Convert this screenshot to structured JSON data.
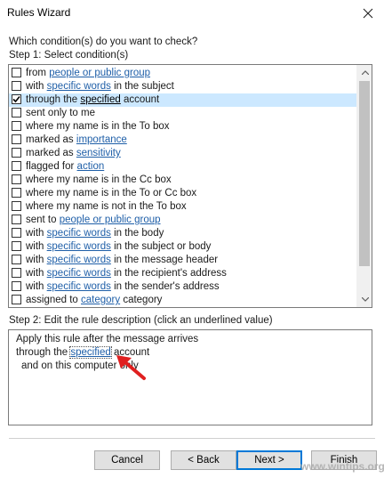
{
  "window": {
    "title": "Rules Wizard",
    "close_icon": "close-icon"
  },
  "prompt": "Which condition(s) do you want to check?",
  "step1_label": "Step 1: Select condition(s)",
  "conditions": [
    {
      "checked": false,
      "selected": false,
      "pre": "from ",
      "link": "people or public group",
      "post": ""
    },
    {
      "checked": false,
      "selected": false,
      "pre": "with ",
      "link": "specific words",
      "post": " in the subject"
    },
    {
      "checked": true,
      "selected": true,
      "pre": "through the ",
      "link": "specified",
      "post": " account"
    },
    {
      "checked": false,
      "selected": false,
      "pre": "sent only to me",
      "link": "",
      "post": ""
    },
    {
      "checked": false,
      "selected": false,
      "pre": "where my name is in the To box",
      "link": "",
      "post": ""
    },
    {
      "checked": false,
      "selected": false,
      "pre": "marked as ",
      "link": "importance",
      "post": ""
    },
    {
      "checked": false,
      "selected": false,
      "pre": "marked as ",
      "link": "sensitivity",
      "post": ""
    },
    {
      "checked": false,
      "selected": false,
      "pre": "flagged for ",
      "link": "action",
      "post": ""
    },
    {
      "checked": false,
      "selected": false,
      "pre": "where my name is in the Cc box",
      "link": "",
      "post": ""
    },
    {
      "checked": false,
      "selected": false,
      "pre": "where my name is in the To or Cc box",
      "link": "",
      "post": ""
    },
    {
      "checked": false,
      "selected": false,
      "pre": "where my name is not in the To box",
      "link": "",
      "post": ""
    },
    {
      "checked": false,
      "selected": false,
      "pre": "sent to ",
      "link": "people or public group",
      "post": ""
    },
    {
      "checked": false,
      "selected": false,
      "pre": "with ",
      "link": "specific words",
      "post": " in the body"
    },
    {
      "checked": false,
      "selected": false,
      "pre": "with ",
      "link": "specific words",
      "post": " in the subject or body"
    },
    {
      "checked": false,
      "selected": false,
      "pre": "with ",
      "link": "specific words",
      "post": " in the message header"
    },
    {
      "checked": false,
      "selected": false,
      "pre": "with ",
      "link": "specific words",
      "post": " in the recipient's address"
    },
    {
      "checked": false,
      "selected": false,
      "pre": "with ",
      "link": "specific words",
      "post": " in the sender's address"
    },
    {
      "checked": false,
      "selected": false,
      "pre": "assigned to ",
      "link": "category",
      "post": " category"
    }
  ],
  "step2_label": "Step 2: Edit the rule description (click an underlined value)",
  "description": {
    "line1": "Apply this rule after the message arrives",
    "line2_pre": "through the ",
    "line2_link": "specified",
    "line2_post": " account",
    "line3": "and on this computer only"
  },
  "buttons": {
    "cancel": "Cancel",
    "back": "< Back",
    "next": "Next >",
    "finish": "Finish"
  },
  "watermark": "www.wintips.org",
  "colors": {
    "link": "#1f5fa8",
    "selection": "#cce8ff",
    "primary_border": "#0078d7",
    "annotation_arrow": "#e02020"
  }
}
